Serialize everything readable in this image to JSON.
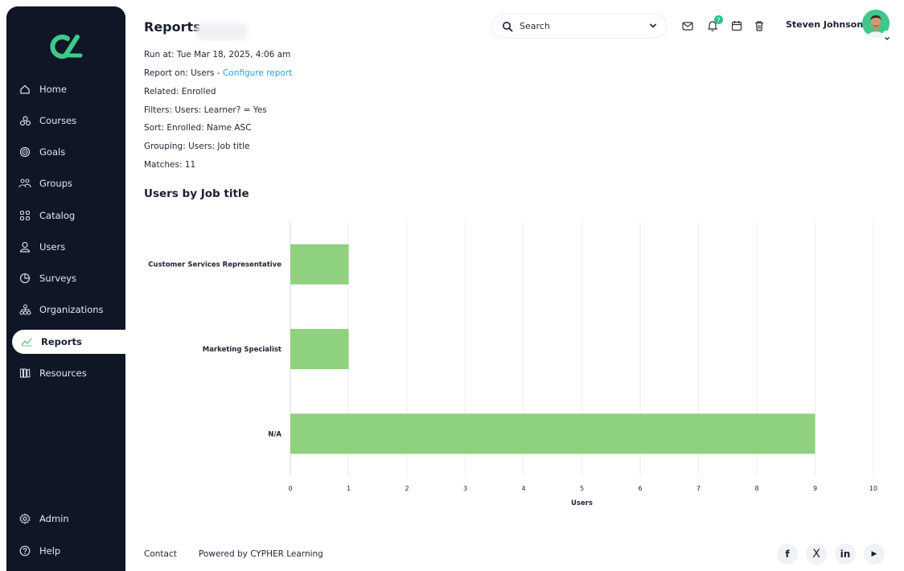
{
  "app": {
    "title": "Reports",
    "colors": {
      "sidebar_bg": "#0f1626",
      "accent": "#27c48a",
      "bar": "#8ed27f",
      "link": "#2b9fd6"
    }
  },
  "sidebar": {
    "logo": "CYPHER Learning logo",
    "items": [
      {
        "label": "Home",
        "icon": "home-icon"
      },
      {
        "label": "Courses",
        "icon": "courses-icon"
      },
      {
        "label": "Goals",
        "icon": "goals-icon"
      },
      {
        "label": "Groups",
        "icon": "groups-icon"
      },
      {
        "label": "Catalog",
        "icon": "catalog-icon"
      },
      {
        "label": "Users",
        "icon": "user-icon"
      },
      {
        "label": "Surveys",
        "icon": "surveys-icon"
      },
      {
        "label": "Organizations",
        "icon": "organizations-icon"
      },
      {
        "label": "Reports",
        "icon": "reports-icon",
        "active": true
      },
      {
        "label": "Resources",
        "icon": "resources-icon"
      }
    ],
    "bottom": [
      {
        "label": "Admin",
        "icon": "gear-icon"
      },
      {
        "label": "Help",
        "icon": "help-icon"
      }
    ]
  },
  "header": {
    "search_placeholder": "Search",
    "notifications_count": "7",
    "user_name": "Steven Johnson"
  },
  "report": {
    "run_at": "Run at: Tue Mar 18, 2025, 4:06 am",
    "report_on_prefix": "Report on: Users - ",
    "configure_link": "Configure report",
    "related": "Related: Enrolled",
    "filters": "Filters: Users: Learner? = Yes",
    "sort": "Sort: Enrolled: Name ASC",
    "grouping": "Grouping: Users: Job title",
    "matches": "Matches: 11"
  },
  "chart_heading": "Users by Job title",
  "chart_data": {
    "type": "bar",
    "orientation": "horizontal",
    "title": "Users by Job title",
    "categories": [
      "Customer Services Representative",
      "Marketing Specialist",
      "N/A"
    ],
    "values": [
      1,
      1,
      9
    ],
    "xlabel": "Users",
    "ylabel": "",
    "xlim": [
      0,
      10
    ],
    "xticks": [
      "0",
      "1",
      "2",
      "3",
      "4",
      "5",
      "6",
      "7",
      "8",
      "9",
      "10"
    ],
    "grid": true,
    "color": "#8ed27f"
  },
  "footer": {
    "contact": "Contact",
    "powered": "Powered by CYPHER Learning",
    "social": [
      {
        "label": "f",
        "icon": "facebook-icon"
      },
      {
        "label": "X",
        "icon": "x-icon"
      },
      {
        "label": "in",
        "icon": "linkedin-icon"
      },
      {
        "label": "▶",
        "icon": "youtube-icon"
      }
    ]
  }
}
